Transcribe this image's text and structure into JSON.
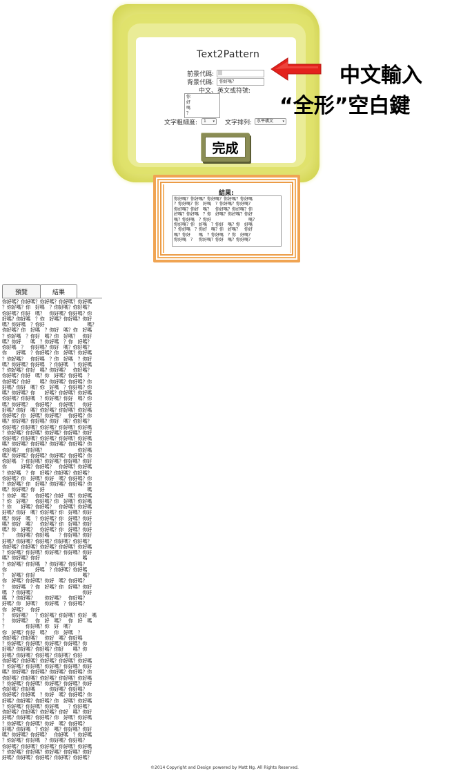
{
  "app": {
    "title": "Text2Pattern"
  },
  "form": {
    "foreground_label": "前景代碼:",
    "foreground_value": "",
    "background_label": "背景代碼:",
    "background_value": "你好嗎？",
    "text_label": "中文、英文或符號:",
    "text_value": "你\n好\n嗎\n？",
    "weight_label": "文字粗細度:",
    "weight_value": "1",
    "arrange_label": "文字排列:",
    "arrange_value": "水平橫文",
    "done_label": "完成"
  },
  "annotation": {
    "line1": "中文輸入",
    "line2": "“全形”空白鍵"
  },
  "result_preview": {
    "label": "結果:",
    "text": "你好嗎？你好嗎？你好嗎？你好嗎？你好嗎\n？你好嗎？你　好嗎　？你好嗎？你好嗎？\n你好嗎？你好　嗎？　你好嗎？你好嗎？你\n好嗎？你好嗎　？你　好嗎？你好嗎？你好\n嗎？你好嗎　？你好　　　　　　　　　嗎？\n你好嗎？你　好嗎　？你好　嗎？你　好嗎\n？你好嗎　？你好　嗎？你　好嗎？　你好\n嗎？你好　　嗎　？你好嗎　？你　好嗎？\n你好嗎　？　你好嗎？你好　嗎？你好嗎？"
  },
  "tabs": {
    "preview": "預覽",
    "result": "結果"
  },
  "long_result": {
    "text": "你好嗎？你好嗎？你好嗎？你好嗎？你好嗎\n？你好嗎？你　好嗎　？你好嗎？你好嗎？\n你好嗎？你好　嗎？　你好嗎？你好嗎？你\n好嗎？你好嗎　？你　好嗎？你好嗎？你好\n嗎？你好嗎　？你好　　　　　　　　　嗎？\n你好嗎？你　好嗎　？你好　嗎？你　好嗎\n？你好嗎　？你好　嗎？你　好嗎？　你好\n嗎？你好　　嗎　？你好嗎　？你　好嗎？\n你好嗎　？　你好嗎？你好　嗎？你好嗎？\n你　　好嗎　？你好嗎？你　好嗎？你好嗎\n？你好嗎？　你好嗎　？你　好嗎　？你好\n嗎？你好嗎？你好嗎　？你好嗎　？你好嗎\n？你好嗎？你好　嗎？你好嗎？　你好嗎？\n你好嗎？你好　嗎？你　好嗎？你好嗎　？\n你好嗎？你好　　嗎？你好嗎？你好嗎？你\n好嗎？你好　嗎？你　好嗎　？你好嗎？你\n嗎？你好嗎？你　　好嗎？你好嗎？你好嗎\n你好嗎？你好嗎　？你好嗎？你好　嗎？你\n嗎？你好嗎？　你好嗎？　你好嗎？　你好\n好嗎？你好　嗎？你好嗎？你好嗎？你好嗎\n你好嗎？你　好嗎？你好嗎？　你好嗎？你\n嗎？你好嗎？你好嗎？你好　嗎？你好嗎？\n你好嗎？你好嗎？你好嗎？你好嗎？你好嗎\n？你好嗎？你好嗎？你好嗎？你好嗎？你好\n你好嗎？你好嗎？你好嗎？你好嗎？你好嗎\n嗎？你好嗎？你好嗎？你好嗎？你好嗎？你\n你好嗎？　你好嗎？　　　　　　　你好嗎\n嗎？你好嗎？你好嗎？你好嗎？你好嗎？你\n你好嗎　？你好嗎？你好嗎？你好嗎？你好\n你　　　好嗎？你好嗎？　你好嗎？你好嗎\n？你好嗎　？你　好嗎？你好嗎？你好嗎？\n你好嗎？你　好嗎？你好　嗎？你好嗎？你\n？你好嗎？你　好嗎？你好嗎？你好嗎？你\n嗎？你好嗎？你　好　　　　　　　　　嗎\n？你好　嗎？　你好嗎？你好　嗎？你好嗎\n？你　好嗎？　你好嗎？你　好嗎？你好嗎\n？你　　好嗎？你好嗎？　你好嗎？你好嗎\n好嗎？你好　嗎？你好嗎？你　好嗎？你好\n嗎？你好　嗎　？你好嗎？你　好嗎？你好\n嗎？你好　嗎？　你好嗎？你　好嗎？你好\n嗎？你　好嗎？　你好嗎？你　好嗎？你好\n？　　你好嗎？你好嗎　　？你好嗎？你好\n好嗎？你好嗎？你好嗎？你好嗎？你好嗎？\n你好嗎？你好嗎？你好嗎？你好嗎？你好嗎\n？你好嗎？你好嗎？你好嗎？你好嗎？你好\n嗎？你好嗎？你好　　　　　　　　　嗎\n？你好嗎？你好嗎　？你好嗎？你好嗎？\n你　　　　　　好嗎　？你好嗎？你好嗎\n？　好嗎？你好　　　　　　　　　　嗎？\n你　好嗎？你好嗎？你好　嗎？你好嗎？\n？　你好嗎　？你　好嗎？你　好嗎？你好\n嗎　？你好嗎？　　　　　　　　　　你好\n嗎　？你好嗎？　　你好嗎？　你好嗎？\n好嗎？你　好嗎？　你好嗎　？你好嗎？\n你　好嗎？　你好\n？　你好嗎？　？你好嗎？你好嗎？你好　嗎\n？　你好嗎？　你　好　嗎？　你　好　嗎\n？　　　　你好嗎？你　好　嗎？\n你　好嗎？你好　嗎？　你　好嗎　？\n你好嗎？你好嗎？　你好　嗎？你好嗎\n？你好嗎？你好嗎？你好嗎？你好嗎？你\n好嗎？你好嗎？你好嗎？你好　　嗎？你\n好嗎？你好嗎？你好嗎？你好嗎？你好\n你好嗎？你好嗎？你好嗎？你好嗎？你好嗎\n？你好嗎？你好嗎？你好嗎？你好嗎？你好\n嗎？你好嗎？你好嗎？你好嗎？你好嗎？你\n你好嗎？你好嗎？你好嗎？你好嗎？你好嗎\n？你好嗎？你好嗎？你好嗎？你好嗎？你好\n你好嗎？你好嗎　　　你好嗎？你好嗎？\n你好嗎？你好嗎　？你好　嗎？你好嗎？你\n好嗎？你好嗎？你好嗎？你　好嗎？你好嗎\n？你好嗎？你好嗎？你好嗎　　？你好嗎？\n你好嗎？你好嗎？你好嗎？你好　嗎？你好\n好嗎？你好嗎？你好嗎？你　好嗎？你好嗎\n？你好嗎？你好嗎？你好　嗎？你好嗎？\n好嗎？你好嗎　？你好　嗎？你好嗎？你好\n嗎？你好嗎？你好嗎？　你好嗎　？你好嗎\n？你好嗎？你好嗎　？你好嗎？你好嗎？\n你好嗎？你好嗎？你好嗎？你好嗎？你好嗎\n？你好嗎？你好嗎？你好嗎？你好嗎？你好\n好嗎？你好嗎？你好嗎？你好嗎？你好嗎？\n嗎？你好嗎？你好嗎？你好嗎？你好嗎？你\n你好嗎？你好嗎？你好嗎？你好嗎？你好嗎\n？你好嗎？你好嗎？你好嗎？你好嗎？你好"
  },
  "footer": {
    "text": "©2014 Copyright and Design powered by Matt Ng. All Rights Reserved."
  },
  "colors": {
    "frame_yellow": "#e6e77f",
    "frame_orange": "#e08a2c",
    "arrow_red": "#e3211c"
  },
  "icons": {
    "arrow": "red-left-arrow"
  }
}
